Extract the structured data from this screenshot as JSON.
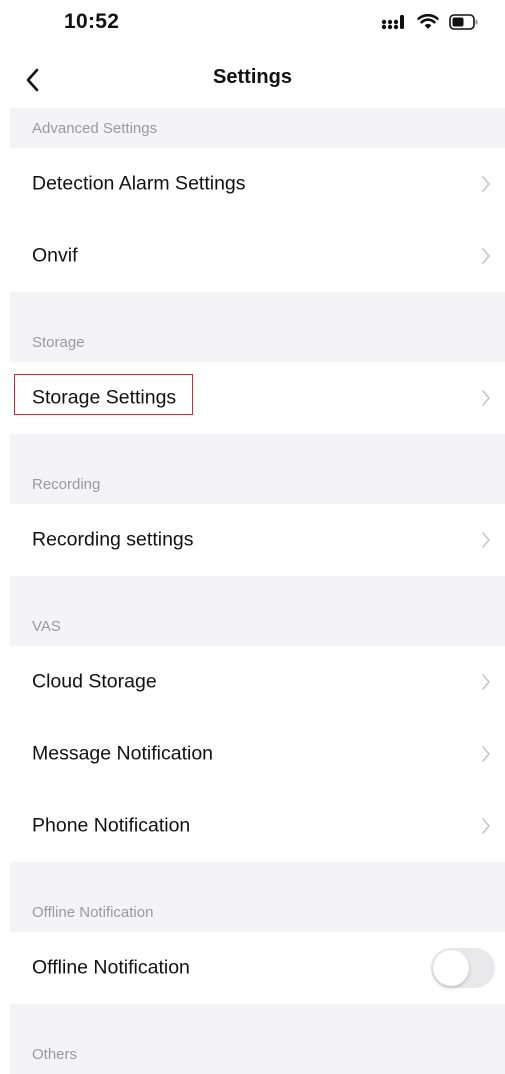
{
  "status_bar": {
    "time": "10:52",
    "signal_icon": "signal-icon",
    "wifi_icon": "wifi-icon",
    "battery_icon": "battery-icon"
  },
  "nav": {
    "title": "Settings",
    "back_icon": "chevron-left-icon"
  },
  "colors": {
    "section_bg": "#f4f4f6",
    "section_text": "#9a9a9e",
    "highlight": "#e0262c",
    "toggle_off": "#e9e9eb"
  },
  "sections": {
    "advanced": {
      "header": "Advanced Settings",
      "items": [
        "Detection Alarm Settings",
        "Onvif"
      ]
    },
    "storage": {
      "header": "Storage",
      "items": [
        "Storage Settings"
      ]
    },
    "recording": {
      "header": "Recording",
      "items": [
        "Recording settings"
      ]
    },
    "vas": {
      "header": "VAS",
      "items": [
        "Cloud Storage",
        "Message Notification",
        "Phone Notification"
      ]
    },
    "offline": {
      "header": "Offline Notification",
      "items": [
        "Offline Notification"
      ],
      "toggle_on": false
    },
    "others": {
      "header": "Others"
    }
  }
}
